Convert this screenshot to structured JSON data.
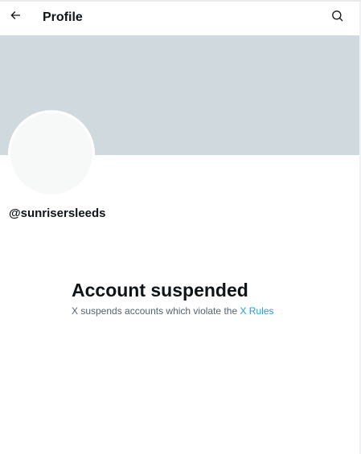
{
  "header": {
    "title": "Profile",
    "back_icon": "arrow-left-icon",
    "search_icon": "search-icon"
  },
  "profile": {
    "handle": "@sunrisersleeds"
  },
  "suspension": {
    "title": "Account suspended",
    "message_prefix": "X suspends accounts which violate the",
    "rules_link": "X Rules"
  },
  "colors": {
    "banner": "#cfd9de",
    "avatar": "#f7f9f9",
    "link": "#1d9bf0",
    "text_primary": "#0f1419",
    "text_secondary": "#536471"
  }
}
